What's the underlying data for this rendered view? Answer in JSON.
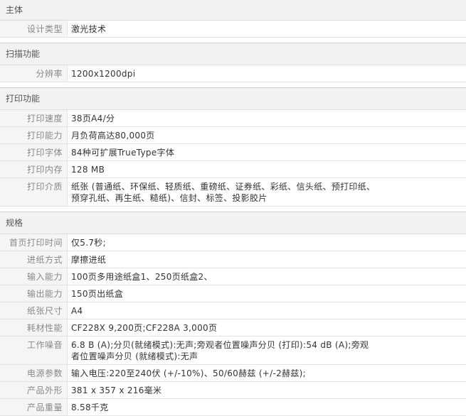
{
  "sections": [
    {
      "title": "主体",
      "rows": [
        {
          "label": "设计类型",
          "value": "激光技术"
        }
      ]
    },
    {
      "title": "扫描功能",
      "rows": [
        {
          "label": "分辨率",
          "value": "1200x1200dpi"
        }
      ]
    },
    {
      "title": "打印功能",
      "rows": [
        {
          "label": "打印速度",
          "value": "38页A4/分"
        },
        {
          "label": "打印能力",
          "value": "月负荷高达80,000页"
        },
        {
          "label": "打印字体",
          "value": "84种可扩展TrueType字体"
        },
        {
          "label": "打印内存",
          "value": "128 MB"
        },
        {
          "label": "打印介质",
          "value": "纸张 (普通纸、环保纸、轻质纸、重磅纸、证券纸、彩纸、信头纸、预打印纸、预穿孔纸、再生纸、糙纸)、信封、标签、投影胶片"
        }
      ]
    },
    {
      "title": "规格",
      "rows": [
        {
          "label": "首页打印时间",
          "value": "仅5.7秒;"
        },
        {
          "label": "进纸方式",
          "value": "摩擦进纸"
        },
        {
          "label": "输入能力",
          "value": "100页多用途纸盒1、250页纸盒2、"
        },
        {
          "label": "输出能力",
          "value": "150页出纸盒"
        },
        {
          "label": "纸张尺寸",
          "value": "A4"
        },
        {
          "label": "耗材性能",
          "value": "CF228X 9,200页;CF228A 3,000页"
        },
        {
          "label": "工作噪音",
          "value": "6.8 B (A);分贝(就绪模式):无声;旁观者位置噪声分贝 (打印):54 dB (A);旁观者位置噪声分贝 (就绪模式):无声"
        },
        {
          "label": "电源参数",
          "value": "输入电压:220至240伏 (+/-10%)、50/60赫兹 (+/-2赫兹);"
        },
        {
          "label": "产品外形",
          "value": "381 x 357 x 216毫米"
        },
        {
          "label": "产品重量",
          "value": "8.58千克"
        }
      ]
    }
  ]
}
